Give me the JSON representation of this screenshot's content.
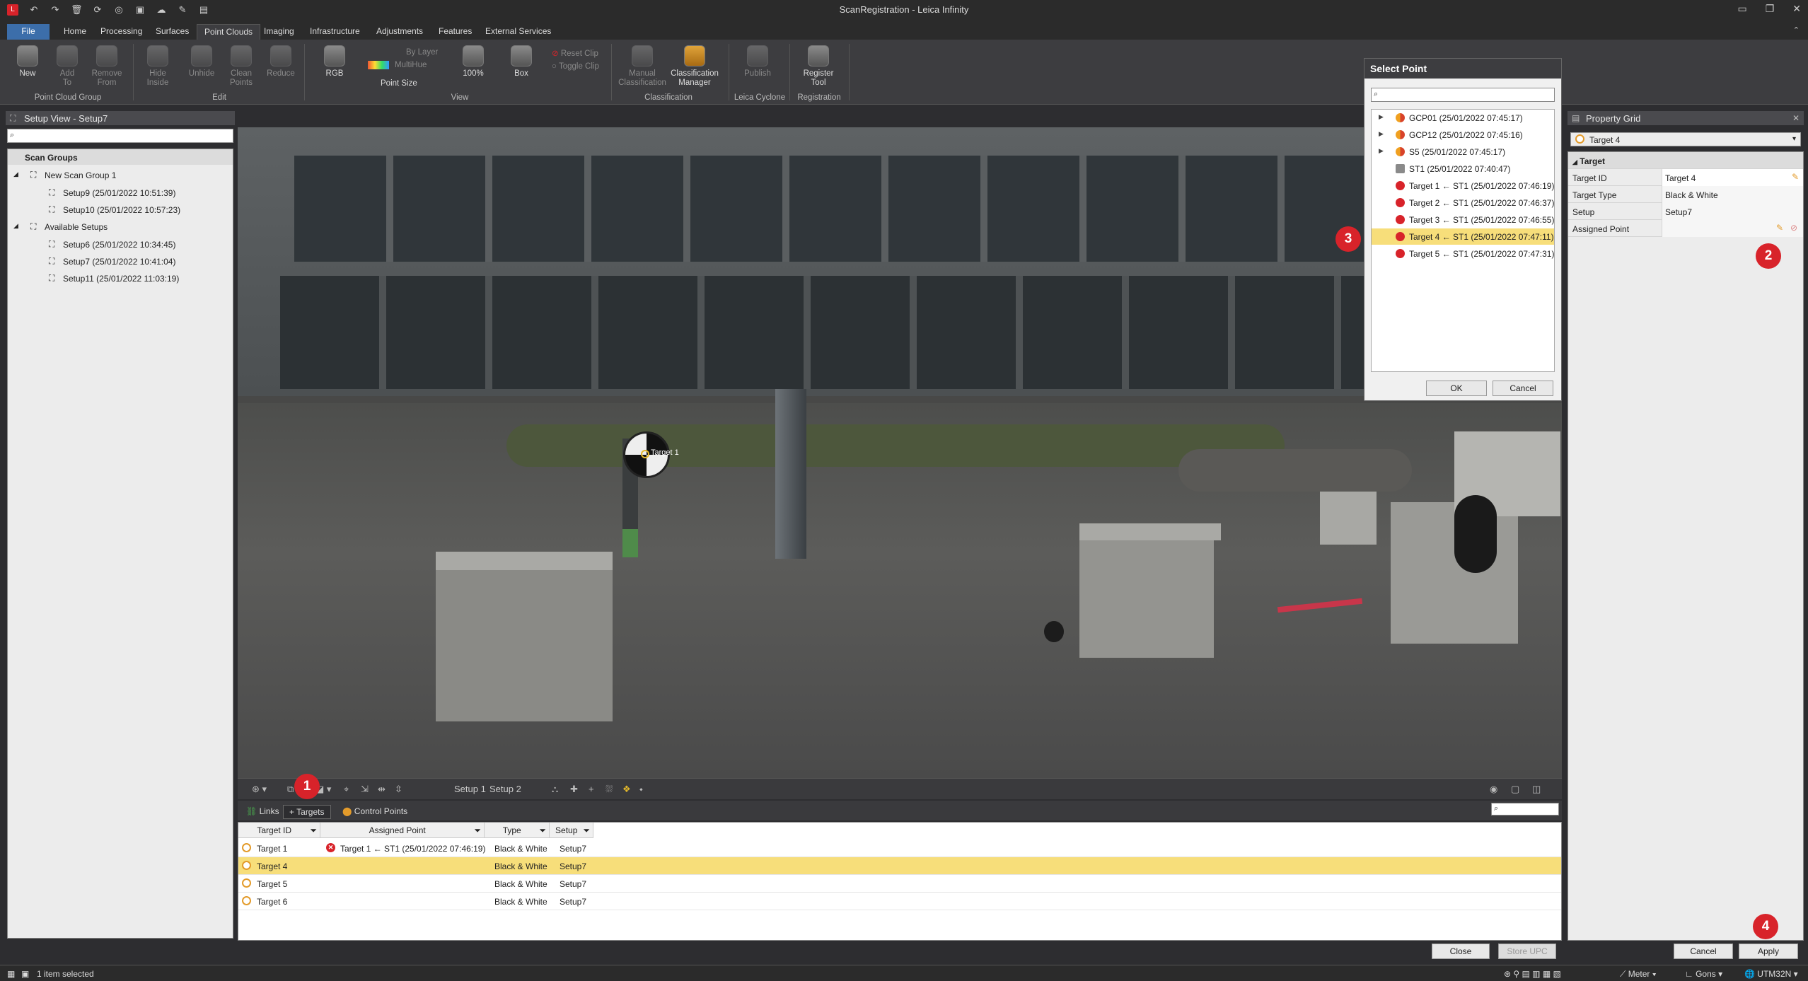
{
  "app": {
    "title": "ScanRegistration - Leica Infinity"
  },
  "tabs": [
    "File",
    "Home",
    "Processing",
    "Surfaces",
    "Point Clouds",
    "Imaging",
    "Infrastructure",
    "Adjustments",
    "Features",
    "External Services"
  ],
  "ribbon": {
    "new": "New",
    "add_to": "Add\nTo",
    "remove_from": "Remove\nFrom",
    "group_point_cloud": "Point Cloud Group",
    "hide_inside": "Hide\nInside",
    "unhide": "Unhide",
    "clean_points": "Clean\nPoints",
    "reduce": "Reduce",
    "group_edit": "Edit",
    "rgb": "RGB",
    "by_layer": "By Layer",
    "multihue": "MultiHue",
    "point_size": "Point Size",
    "percent": "100%",
    "box": "Box",
    "reset_clip": "Reset Clip",
    "toggle_clip": "Toggle Clip",
    "group_view": "View",
    "manual_classification": "Manual\nClassification",
    "classification_manager": "Classification\nManager",
    "group_classification": "Classification",
    "publish": "Publish",
    "group_cyclone": "Leica Cyclone",
    "register_tool": "Register\nTool",
    "group_registration": "Registration"
  },
  "left": {
    "header": "Setup View - Setup7",
    "tree_title": "Scan Groups",
    "new_group": "New Scan Group 1",
    "setup9": "Setup9 (25/01/2022 10:51:39)",
    "setup10": "Setup10 (25/01/2022 10:57:23)",
    "available": "Available Setups",
    "setup6": "Setup6 (25/01/2022 10:34:45)",
    "setup7": "Setup7 (25/01/2022 10:41:04)",
    "setup11": "Setup11 (25/01/2022 11:03:19)"
  },
  "viewport": {
    "target_label": "Target 1"
  },
  "vp_toolbar": {
    "setup1": "Setup 1",
    "setup2": "Setup 2"
  },
  "bottom": {
    "tab_links": "Links",
    "tab_targets": "Targets",
    "tab_control": "Control Points",
    "columns": [
      "Target ID",
      "Assigned Point",
      "Type",
      "Setup"
    ],
    "rows": [
      {
        "id": "Target 1",
        "assigned": "Target 1 ← ST1 (25/01/2022 07:46:19)",
        "type": "Black & White",
        "setup": "Setup7"
      },
      {
        "id": "Target 4",
        "assigned": "",
        "type": "Black & White",
        "setup": "Setup7"
      },
      {
        "id": "Target 5",
        "assigned": "",
        "type": "Black & White",
        "setup": "Setup7"
      },
      {
        "id": "Target 6",
        "assigned": "",
        "type": "Black & White",
        "setup": "Setup7"
      }
    ],
    "close": "Close",
    "store_upc": "Store UPC"
  },
  "dialog": {
    "title": "Select Point",
    "items": [
      "GCP01 (25/01/2022 07:45:17)",
      "GCP12 (25/01/2022 07:45:16)",
      "S5 (25/01/2022 07:45:17)",
      "ST1 (25/01/2022 07:40:47)",
      "Target 1 ← ST1 (25/01/2022 07:46:19)",
      "Target 2 ← ST1 (25/01/2022 07:46:37)",
      "Target 3 ← ST1 (25/01/2022 07:46:55)",
      "Target 4 ← ST1 (25/01/2022 07:47:11)",
      "Target 5 ← ST1 (25/01/2022 07:47:31)"
    ],
    "ok": "OK",
    "cancel": "Cancel"
  },
  "property_grid": {
    "header": "Property Grid",
    "selected": "Target 4",
    "section": "Target",
    "target_id_label": "Target ID",
    "target_id": "Target 4",
    "target_type_label": "Target Type",
    "target_type": "Black & White",
    "setup_label": "Setup",
    "setup": "Setup7",
    "assigned_label": "Assigned Point",
    "cancel": "Cancel",
    "apply": "Apply"
  },
  "badges": [
    "1",
    "2",
    "3",
    "4"
  ],
  "status": {
    "selected": "1 item selected",
    "unit": "Meter",
    "angle": "Gons",
    "crs": "UTM32N"
  },
  "colors": {
    "accent": "#3c6eaa",
    "selection": "#f7de7a",
    "badge": "#d8232a"
  }
}
